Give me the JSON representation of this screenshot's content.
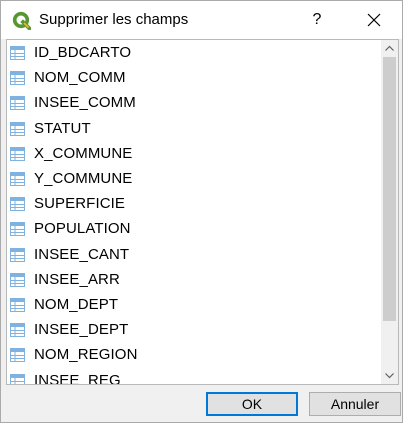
{
  "window": {
    "title": "Supprimer les champs",
    "help_label": "?",
    "close_label": "✕"
  },
  "icons": {
    "app": "qgis-logo-icon",
    "field": "table-field-icon",
    "scroll_up": "chevron-up-icon",
    "scroll_down": "chevron-down-icon"
  },
  "fields": [
    {
      "label": "ID_BDCARTO"
    },
    {
      "label": "NOM_COMM"
    },
    {
      "label": "INSEE_COMM"
    },
    {
      "label": "STATUT"
    },
    {
      "label": "X_COMMUNE"
    },
    {
      "label": "Y_COMMUNE"
    },
    {
      "label": "SUPERFICIE"
    },
    {
      "label": "POPULATION"
    },
    {
      "label": "INSEE_CANT"
    },
    {
      "label": "INSEE_ARR"
    },
    {
      "label": "NOM_DEPT"
    },
    {
      "label": "INSEE_DEPT"
    },
    {
      "label": "NOM_REGION"
    },
    {
      "label": "INSEE_REG"
    }
  ],
  "buttons": {
    "ok_label": "OK",
    "cancel_label": "Annuler"
  },
  "colors": {
    "accent": "#0078d7",
    "qgis_green": "#589632",
    "qgis_yellow": "#eeb830",
    "field_icon_blue": "#7fb2de"
  }
}
